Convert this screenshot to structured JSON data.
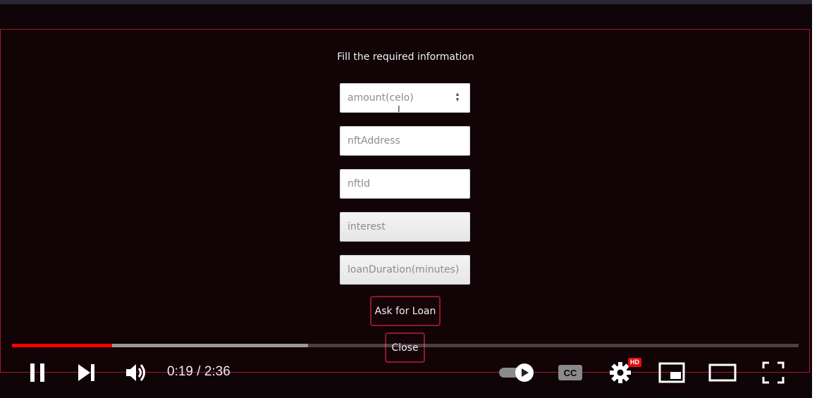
{
  "modal": {
    "title": "Fill the required information",
    "fields": [
      {
        "placeholder": "amount(celo)",
        "type": "number"
      },
      {
        "placeholder": "nftAddress",
        "type": "text"
      },
      {
        "placeholder": "nftId",
        "type": "text"
      },
      {
        "placeholder": "interest",
        "type": "text"
      },
      {
        "placeholder": "loanDuration(minutes)",
        "type": "text"
      }
    ],
    "submit_label": "Ask for Loan",
    "close_label": "Close"
  },
  "player": {
    "time_display": "0:19 / 2:36",
    "played_fraction": 0.127,
    "buffered_fraction": 0.376,
    "quality_badge": "HD",
    "accent_color": "#ff0000",
    "icons": [
      "pause-icon",
      "next-icon",
      "volume-icon",
      "autoplay-toggle-icon",
      "cc-icon",
      "settings-icon",
      "miniplayer-icon",
      "theater-icon",
      "fullscreen-icon"
    ]
  }
}
